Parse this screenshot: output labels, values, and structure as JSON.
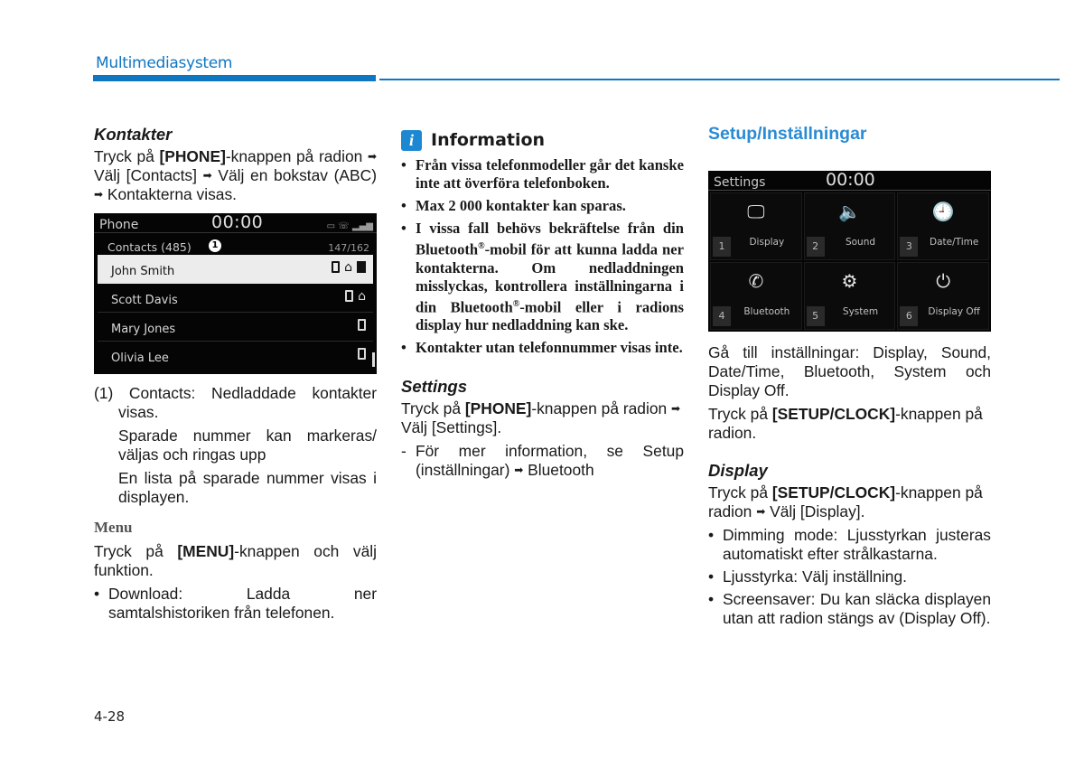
{
  "header": {
    "section_title": "Multimediasystem",
    "accent_color": "#0f76c2"
  },
  "col1": {
    "contacts_heading": "Kontakter",
    "contacts_intro": {
      "pre": "Tryck på ",
      "key": "[PHONE]",
      "post": "-knappen på radion",
      "step1": "Välj [Contacts]",
      "step2": "Välj en bokstav (ABC)",
      "step3": "Kontakterna visas."
    },
    "phone_screen": {
      "title": "Phone",
      "time": "00:00",
      "status_icons": [
        "battery-icon",
        "bluetooth-phone-icon",
        "signal-icon"
      ],
      "contacts_label": "Contacts (485)",
      "callout": "1",
      "count": "147/162",
      "contacts": [
        {
          "name": "John Smith",
          "icons": [
            "mobile",
            "home",
            "office"
          ],
          "selected": true
        },
        {
          "name": "Scott Davis",
          "icons": [
            "mobile",
            "home"
          ],
          "selected": false
        },
        {
          "name": "Mary Jones",
          "icons": [
            "mobile"
          ],
          "selected": false
        },
        {
          "name": "Olivia Lee",
          "icons": [
            "mobile"
          ],
          "selected": false
        }
      ]
    },
    "notes": {
      "n1": "(1) Contacts: Nedladdade kontakter visas.",
      "n2": "Sparade nummer kan markeras/ väljas och ringas upp",
      "n3": "En lista på sparade nummer visas i displayen."
    },
    "menu_heading": "Menu",
    "menu_intro": {
      "pre": "Tryck på ",
      "key": "[MENU]",
      "post": "-knappen och välj funktion."
    },
    "menu_bullets": [
      "Download: Ladda ner samtalshistoriken från telefonen."
    ]
  },
  "col2": {
    "info_title": "Information",
    "info_bullets": {
      "b1": "Från vissa telefonmodeller går det kanske inte att överföra telefonboken.",
      "b2": "Max 2 000 kontakter kan sparas.",
      "b3a": "I vissa fall behövs bekräftelse från din Bluetooth",
      "b3b": "-mobil för att kunna ladda ner kontakterna. Om nedladdningen misslyckas, kontrollera inställningarna i din Bluetooth",
      "b3c": "-mobil eller i radions display hur nedladdning kan ske.",
      "reg": "®",
      "b4": "Kontakter utan telefonnummer visas inte."
    },
    "settings_heading": "Settings",
    "settings_intro": {
      "pre": "Tryck på ",
      "key": "[PHONE]",
      "post": "-knappen på radion",
      "step": "Välj [Settings]."
    },
    "settings_dash": {
      "pre": "För mer information, se Setup (inställningar)",
      "post": "Bluetooth"
    }
  },
  "col3": {
    "setup_heading": "Setup/Inställningar",
    "setup_color": "#2b8bd3",
    "settings_screen": {
      "title": "Settings",
      "time": "00:00",
      "items": [
        {
          "num": "1",
          "label": "Display",
          "icon": "display-icon"
        },
        {
          "num": "2",
          "label": "Sound",
          "icon": "speaker-icon"
        },
        {
          "num": "3",
          "label": "Date/Time",
          "icon": "clock-icon"
        },
        {
          "num": "4",
          "label": "Bluetooth",
          "icon": "bluetooth-phone-icon"
        },
        {
          "num": "5",
          "label": "System",
          "icon": "gear-icon"
        },
        {
          "num": "6",
          "label": "Display Off",
          "icon": "power-display-icon"
        }
      ]
    },
    "goto_text": "Gå till inställningar: Display, Sound, Date/Time, Bluetooth, System och Display Off.",
    "setup_intro": {
      "pre": "Tryck på ",
      "key": "[SETUP/CLOCK]",
      "post": "-knappen på radion."
    },
    "display_heading": "Display",
    "display_intro": {
      "pre": "Tryck på ",
      "key": "[SETUP/CLOCK]",
      "post": "-knappen på radion",
      "step": "Välj [Display]."
    },
    "display_bullets": [
      "Dimming mode: Ljusstyrkan justeras automatiskt efter strålkastarna.",
      "Ljusstyrka: Välj inställning.",
      "Screensaver: Du kan släcka displayen utan att radion stängs av (Display Off)."
    ]
  },
  "footer": {
    "page_number": "4-28"
  }
}
